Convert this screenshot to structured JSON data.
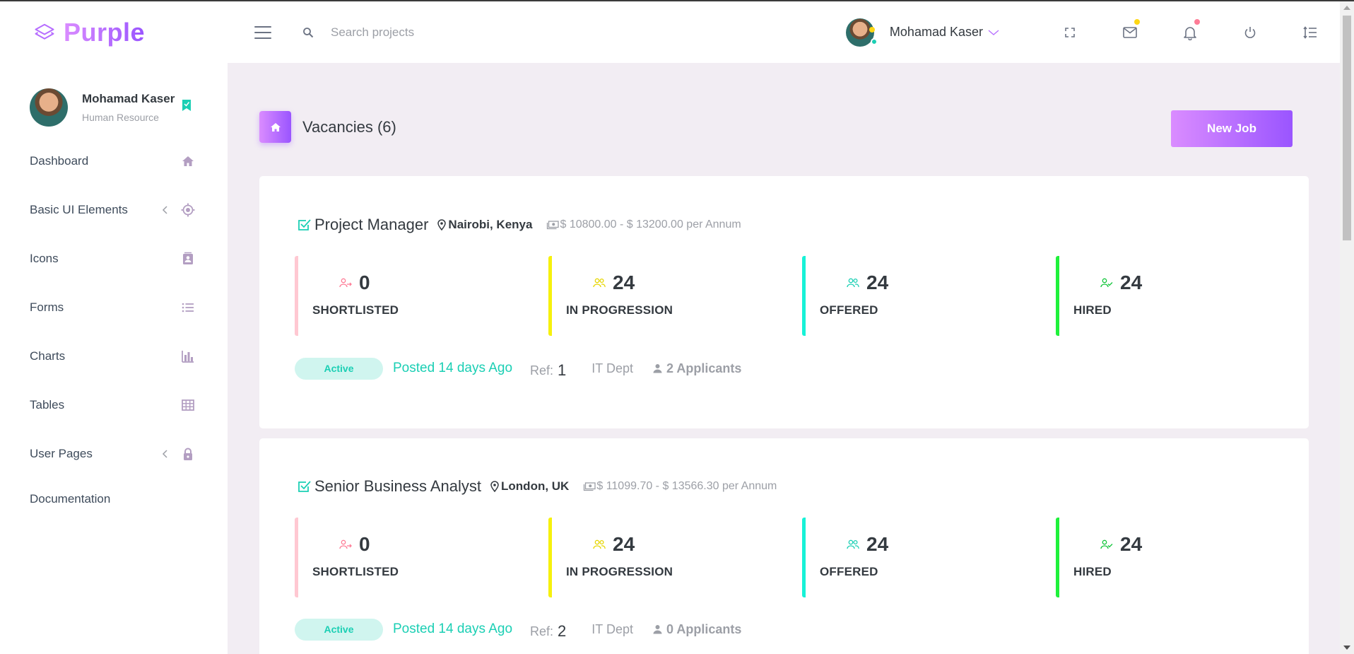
{
  "brand": {
    "name": "Purple"
  },
  "search": {
    "placeholder": "Search projects"
  },
  "user": {
    "name": "Mohamad Kaser",
    "role": "Human Resource"
  },
  "sidebar": {
    "items": [
      {
        "label": "Dashboard",
        "icon": "home-icon"
      },
      {
        "label": "Basic UI Elements",
        "icon": "crosshair-icon",
        "expandable": true
      },
      {
        "label": "Icons",
        "icon": "contacts-icon"
      },
      {
        "label": "Forms",
        "icon": "list-icon"
      },
      {
        "label": "Charts",
        "icon": "chart-bar-icon"
      },
      {
        "label": "Tables",
        "icon": "table-icon"
      },
      {
        "label": "User Pages",
        "icon": "lock-icon",
        "expandable": true
      },
      {
        "label": "Documentation"
      }
    ]
  },
  "page": {
    "title": "Vacancies (6)",
    "new_job_label": "New Job"
  },
  "jobs": [
    {
      "title": "Project Manager",
      "location": "Nairobi, Kenya",
      "salary": "$ 10800.00 - $ 13200.00 per Annum",
      "stats": [
        {
          "value": "0",
          "label": "SHORTLISTED"
        },
        {
          "value": "24",
          "label": "IN PROGRESSION"
        },
        {
          "value": "24",
          "label": "OFFERED"
        },
        {
          "value": "24",
          "label": "HIRED"
        }
      ],
      "status": "Active",
      "posted": "Posted 14 days Ago",
      "ref_label": "Ref:",
      "ref": "1",
      "dept": "IT Dept",
      "applicants": "2 Applicants"
    },
    {
      "title": "Senior Business Analyst",
      "location": "London, UK",
      "salary": "$ 11099.70 - $ 13566.30 per Annum",
      "stats": [
        {
          "value": "0",
          "label": "SHORTLISTED"
        },
        {
          "value": "24",
          "label": "IN PROGRESSION"
        },
        {
          "value": "24",
          "label": "OFFERED"
        },
        {
          "value": "24",
          "label": "HIRED"
        }
      ],
      "status": "Active",
      "posted": "Posted 14 days Ago",
      "ref_label": "Ref:",
      "ref": "2",
      "dept": "IT Dept",
      "applicants": "0 Applicants"
    }
  ],
  "colors": {
    "accent": "#b66dff",
    "success": "#1bcfb4",
    "shortlisted": "#ffc8d2",
    "progression": "#f6f10d",
    "offered": "#17f2d7",
    "hired": "#1ff13b"
  }
}
